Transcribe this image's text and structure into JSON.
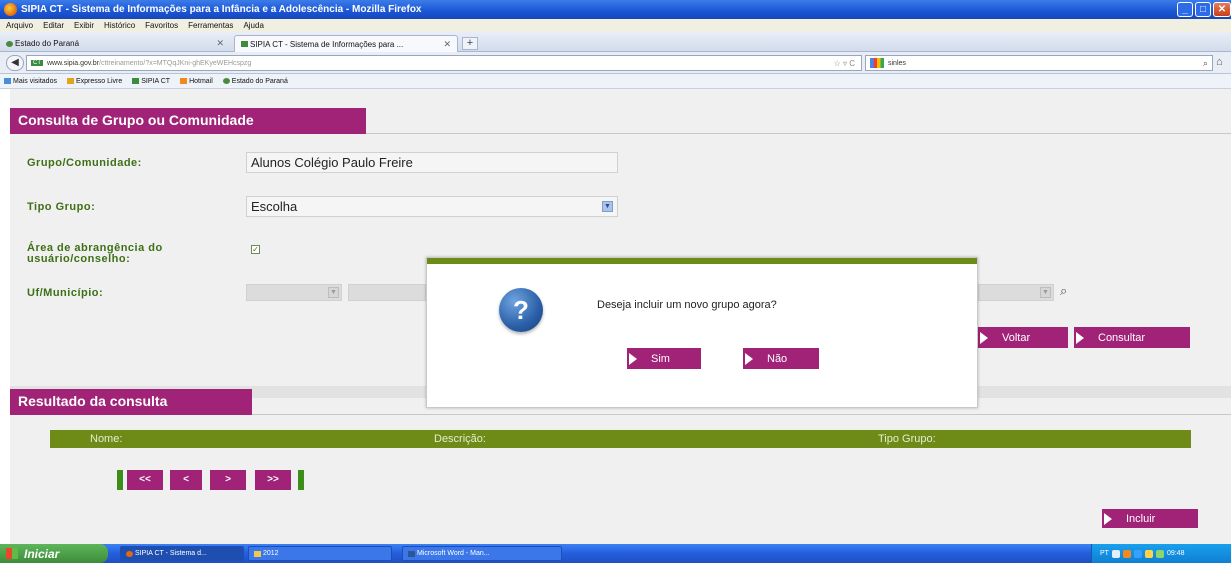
{
  "window": {
    "title": "SIPIA CT - Sistema de Informações para a Infância e a Adolescência - Mozilla Firefox"
  },
  "menu": [
    "Arquivo",
    "Editar",
    "Exibir",
    "Histórico",
    "Favoritos",
    "Ferramentas",
    "Ajuda"
  ],
  "tabs": [
    {
      "label": "Estado do Paraná",
      "active": false
    },
    {
      "label": "SIPIA CT - Sistema de Informações para ...",
      "active": true
    }
  ],
  "nav": {
    "url_host": "www.sipia.gov.br",
    "url_path": "/cttreinamento/?x=MTQqJKni-ghEKyeWEHcspzg",
    "search_value": "sinles"
  },
  "bookmarks": [
    "Mais visitados",
    "Expresso Livre",
    "SIPIA CT",
    "Hotmail",
    "Estado do Paraná"
  ],
  "form": {
    "title": "Consulta de Grupo ou Comunidade",
    "grupo_label": "Grupo/Comunidade:",
    "grupo_value": "Alunos Colégio Paulo Freire",
    "tipo_label": "Tipo Grupo:",
    "tipo_value": "Escolha",
    "area_label_1": "Área de abrangência do",
    "area_label_2": "usuário/conselho:",
    "area_checked": true,
    "uf_label": "Uf/Município:",
    "voltar_label": "Voltar",
    "consultar_label": "Consultar"
  },
  "results": {
    "title": "Resultado da consulta",
    "columns": [
      "Nome:",
      "Descrição:",
      "Tipo Grupo:"
    ],
    "pager": [
      "<<",
      "<",
      ">",
      ">>"
    ],
    "incluir_label": "Incluir"
  },
  "dialog": {
    "message": "Deseja incluir um novo grupo agora?",
    "yes_label": "Sim",
    "no_label": "Não",
    "icon": "question-icon"
  },
  "taskbar": {
    "start_label": "Iniciar",
    "items": [
      "SIPIA CT - Sistema d...",
      "2012",
      "Microsoft Word - Man..."
    ],
    "lang": "PT",
    "clock": "09:48"
  },
  "colors": {
    "accent": "#a12378",
    "green": "#6f8b17",
    "label_green": "#3e7016"
  }
}
